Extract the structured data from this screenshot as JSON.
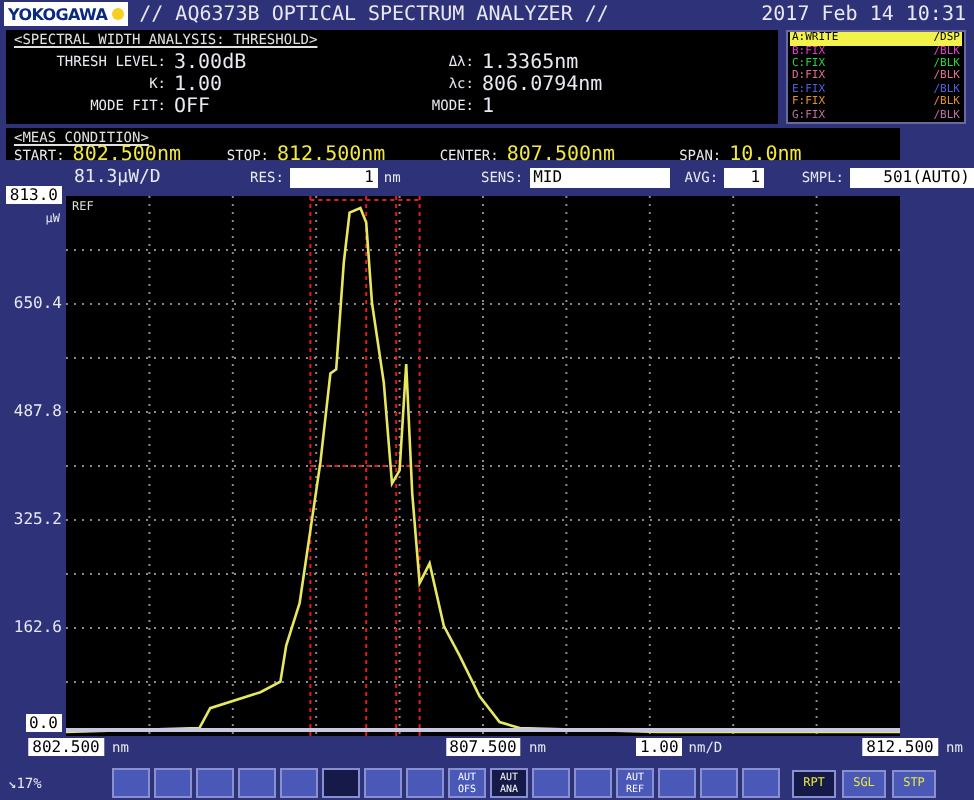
{
  "header": {
    "logo": "YOKOGAWA",
    "title": "// AQ6373B OPTICAL SPECTRUM ANALYZER //",
    "datetime": "2017 Feb 14 10:31"
  },
  "analysis": {
    "heading": "<SPECTRAL WIDTH ANALYSIS: THRESHOLD>",
    "left_fields": [
      {
        "label": "THRESH LEVEL:",
        "value": "3.00dB"
      },
      {
        "label": "K:",
        "value": "1.00"
      },
      {
        "label": "MODE FIT:",
        "value": "OFF"
      }
    ],
    "right_fields": [
      {
        "label": "Δλ:",
        "value": "1.3365nm"
      },
      {
        "label": "λc:",
        "value": "806.0794nm"
      },
      {
        "label": "MODE:",
        "value": "1"
      }
    ]
  },
  "traces": [
    {
      "name": "A:WRITE",
      "mode": "/DSP",
      "selected": true,
      "color": "#f2f24a"
    },
    {
      "name": "B:FIX",
      "mode": "/BLK",
      "selected": false,
      "color": "#e040c0"
    },
    {
      "name": "C:FIX",
      "mode": "/BLK",
      "selected": false,
      "color": "#30d040"
    },
    {
      "name": "D:FIX",
      "mode": "/BLK",
      "selected": false,
      "color": "#e07090"
    },
    {
      "name": "E:FIX",
      "mode": "/BLK",
      "selected": false,
      "color": "#5060e0"
    },
    {
      "name": "F:FIX",
      "mode": "/BLK",
      "selected": false,
      "color": "#e09030"
    },
    {
      "name": "G:FIX",
      "mode": "/BLK",
      "selected": false,
      "color": "#c070a0"
    }
  ],
  "meas_condition": {
    "heading": "<MEAS CONDITION>",
    "fields": [
      {
        "label": "START:",
        "value": "802.500nm"
      },
      {
        "label": "STOP:",
        "value": "812.500nm"
      },
      {
        "label": "CENTER:",
        "value": "807.500nm"
      },
      {
        "label": "SPAN:",
        "value": "10.0nm"
      }
    ]
  },
  "scale": {
    "per_div": "81.3µW/D",
    "fields": [
      {
        "label": "RES:",
        "value": "1",
        "unit": "nm"
      },
      {
        "label": "SENS:",
        "value": "MID"
      },
      {
        "label": "AVG:",
        "value": "1"
      },
      {
        "label": "SMPL:",
        "value": "501(AUTO)"
      }
    ]
  },
  "graph": {
    "ref_label": "REF",
    "chart_data": {
      "type": "line",
      "grid": true,
      "ref_lines": [
        {
          "axis": "x",
          "value": 805.43,
          "color": "#e02020"
        },
        {
          "axis": "x",
          "value": 806.1,
          "color": "#e02020"
        },
        {
          "axis": "x",
          "value": 806.46,
          "color": "#e02020"
        },
        {
          "axis": "x",
          "value": 806.74,
          "color": "#e02020"
        },
        {
          "axis": "y",
          "value": 406.5,
          "color": "#e02020"
        },
        {
          "axis": "y",
          "value": 807,
          "color": "#e02020"
        }
      ],
      "ylabel": "µW",
      "xlim": [
        802.5,
        812.5
      ],
      "ylim": [
        0,
        813
      ],
      "yticks": [
        {
          "value": 813,
          "label": "813.0"
        },
        {
          "value": 650.4,
          "label": "650.4"
        },
        {
          "value": 487.8,
          "label": "487.8"
        },
        {
          "value": 325.2,
          "label": "325.2"
        },
        {
          "value": 162.6,
          "label": "162.6"
        },
        {
          "value": 0,
          "label": "0.0"
        }
      ],
      "x": [
        802.5,
        804.1,
        804.23,
        804.83,
        805.07,
        805.14,
        805.3,
        805.55,
        805.67,
        805.74,
        805.83,
        805.9,
        806.03,
        806.1,
        806.17,
        806.31,
        806.41,
        806.5,
        806.58,
        806.65,
        806.74,
        806.86,
        807.03,
        807.22,
        807.46,
        807.7,
        807.94,
        809.6,
        812.5
      ],
      "xticks": [
        {
          "value": 802.5,
          "label": "802.500"
        },
        {
          "value": 807.5,
          "label": "807.500"
        },
        {
          "value": 812.5,
          "label": "812.500"
        }
      ],
      "series": [
        {
          "color": "#e8e860",
          "values": [
            6,
            12,
            42,
            66,
            82,
            136,
            200,
            412,
            546,
            552,
            713,
            788,
            795,
            773,
            652,
            532,
            380,
            400,
            560,
            366,
            230,
            260,
            166,
            121,
            60,
            21,
            12,
            6,
            6
          ]
        }
      ]
    }
  },
  "x_axis": {
    "tick_units": [
      "nm",
      "nm",
      "nm"
    ],
    "per_div": "1.00",
    "per_div_unit": "nm/D"
  },
  "footer": {
    "indicator": "↘17%",
    "softkeys": [
      {
        "kind": "blank",
        "selected": false
      },
      {
        "kind": "blank",
        "selected": false
      },
      {
        "kind": "blank",
        "selected": false
      },
      {
        "kind": "blank",
        "selected": false
      },
      {
        "kind": "blank",
        "selected": false
      },
      {
        "kind": "blank",
        "selected": true
      },
      {
        "kind": "blank",
        "selected": false
      },
      {
        "kind": "blank",
        "selected": false
      },
      {
        "kind": "text",
        "label": "AUT OFS",
        "selected": false
      },
      {
        "kind": "text",
        "label": "AUT ANA",
        "selected": true
      },
      {
        "kind": "blank",
        "selected": false
      },
      {
        "kind": "blank",
        "selected": false
      },
      {
        "kind": "text",
        "label": "AUT REF",
        "selected": false
      },
      {
        "kind": "blank",
        "selected": false
      },
      {
        "kind": "blank",
        "selected": false
      },
      {
        "kind": "blank",
        "selected": false
      }
    ],
    "run_keys": [
      {
        "label": "RPT",
        "selected": true
      },
      {
        "label": "SGL",
        "selected": false
      },
      {
        "label": "STP",
        "selected": false
      }
    ]
  }
}
